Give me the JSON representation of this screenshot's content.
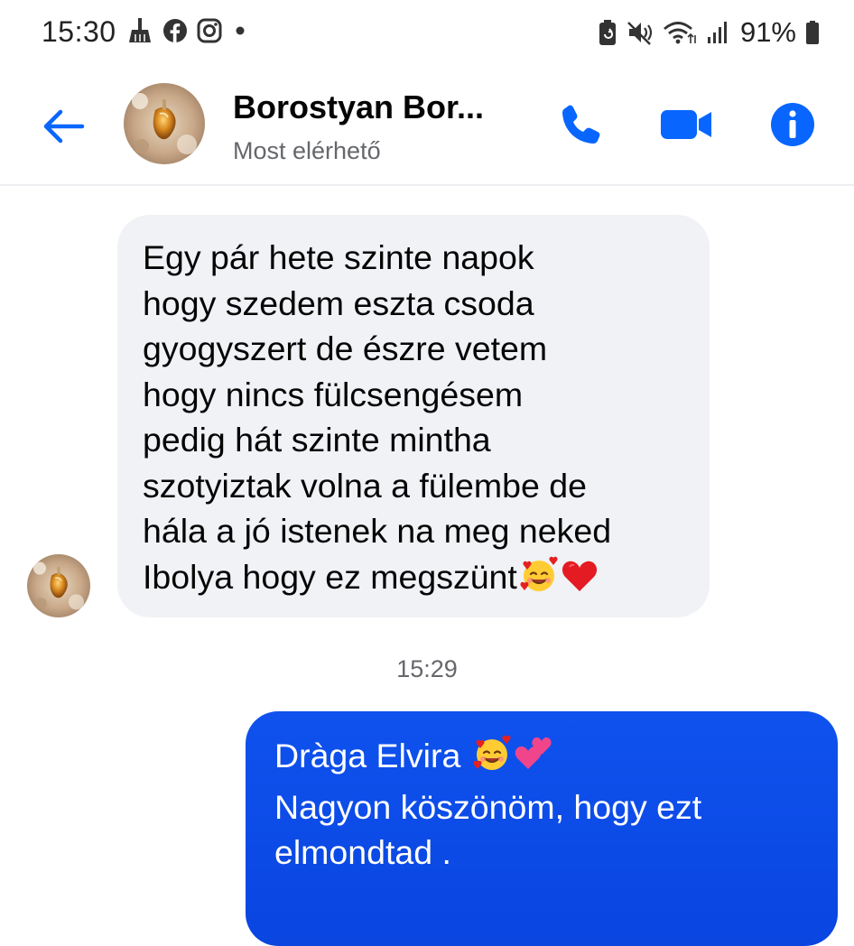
{
  "status_bar": {
    "time": "15:30",
    "battery_percent": "91%",
    "icons_left": [
      "broom-icon",
      "facebook-icon",
      "instagram-icon",
      "dot-icon"
    ],
    "icons_right": [
      "battery-saver-icon",
      "mute-icon",
      "wifi-icon",
      "signal-icon",
      "battery-icon"
    ]
  },
  "header": {
    "contact_name": "Borostyan Bor...",
    "contact_status": "Most elérhető",
    "accent_color": "#0866ff"
  },
  "conversation": {
    "incoming_message": {
      "lines": [
        "Egy pár hete szinte napok",
        "hogy szedem eszta csoda",
        "gyogyszert de észre vetem",
        "hogy nincs fülcsengésem",
        "pedig hát szinte mintha",
        "szotyiztak volna a fülembe de",
        "hála a jó istenek na meg neked",
        "Ibolya hogy ez megszünt"
      ],
      "emoji_after_last_line": [
        "smiling-face-with-hearts-icon",
        "red-heart-icon"
      ]
    },
    "timestamp": "15:29",
    "outgoing_message": {
      "lines": [
        "Dràga Elvira",
        "Nagyon köszönöm,  hogy ezt",
        "elmondtad ."
      ],
      "emoji_after_first_line": [
        "smiling-face-with-hearts-icon",
        "two-hearts-icon"
      ],
      "bubble_color": "#0a4ee8"
    }
  }
}
